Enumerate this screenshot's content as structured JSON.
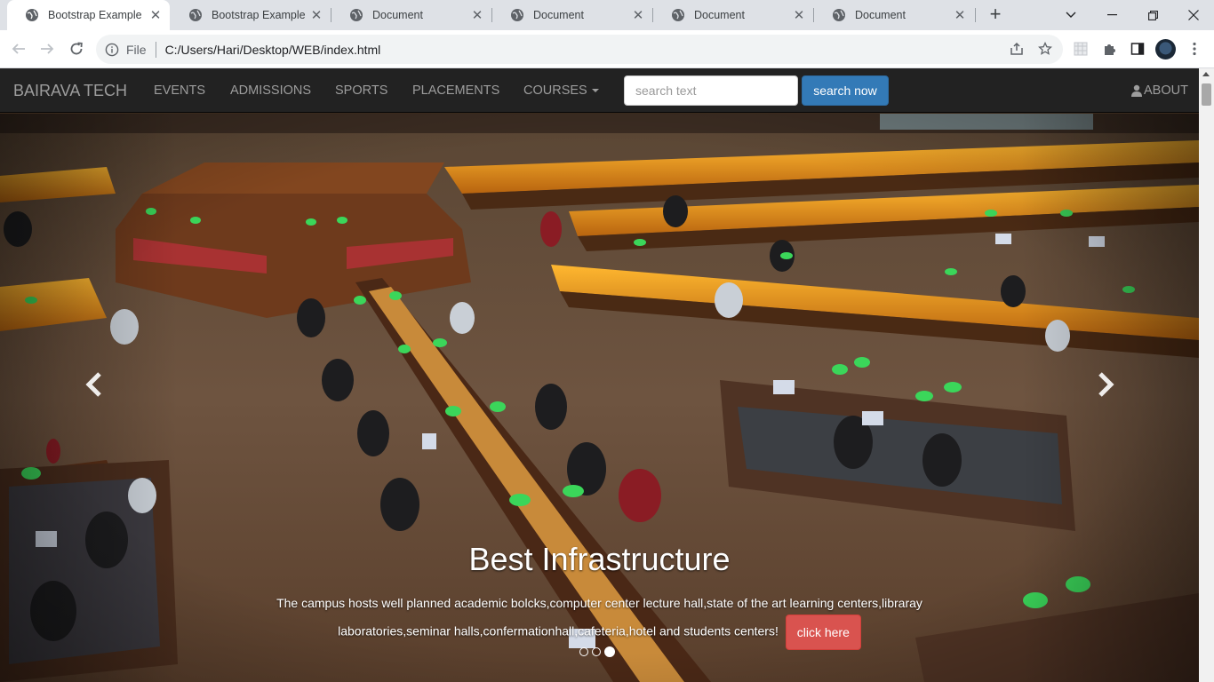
{
  "browser": {
    "tabs": [
      {
        "title": "Bootstrap Example",
        "active": true
      },
      {
        "title": "Bootstrap Example",
        "active": false
      },
      {
        "title": "Document",
        "active": false
      },
      {
        "title": "Document",
        "active": false
      },
      {
        "title": "Document",
        "active": false
      },
      {
        "title": "Document",
        "active": false
      }
    ],
    "address": {
      "scheme_label": "File",
      "url": "C:/Users/Hari/Desktop/WEB/index.html"
    }
  },
  "navbar": {
    "brand": "BAIRAVA TECH",
    "links": [
      "EVENTS",
      "ADMISSIONS",
      "SPORTS",
      "PLACEMENTS",
      "COURSES"
    ],
    "search_placeholder": "search text",
    "search_button": "search now",
    "about": "ABOUT"
  },
  "carousel": {
    "caption_title": "Best Infrastructure",
    "caption_text_line1": "The campus hosts well planned academic bolcks,computer center lecture hall,state of the art learning centers,libraray",
    "caption_text_line2": "laboratories,seminar halls,confermationhall,cafeteria,hotel and students centers!",
    "caption_button": "click here",
    "slide_count": 3,
    "active_slide": 3
  },
  "colors": {
    "navbar_bg": "#222222",
    "navbar_text": "#9d9d9d",
    "primary_button": "#337ab7",
    "danger_button": "#d9534f"
  }
}
